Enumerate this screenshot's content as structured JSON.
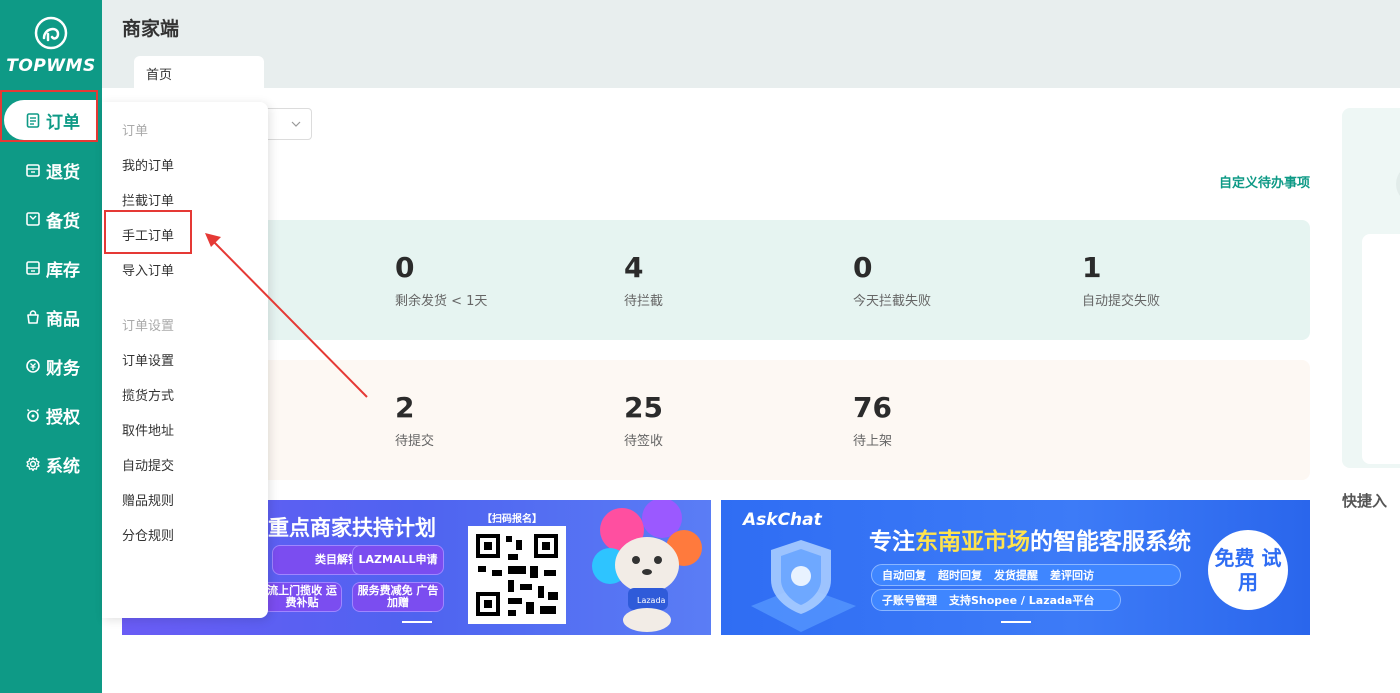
{
  "app": {
    "logo_text": "TOPWMS",
    "title": "商家端",
    "accent_color": "#0e9a86"
  },
  "tabs": [
    {
      "label": "首页"
    }
  ],
  "sidebar": {
    "items": [
      {
        "label": "订单",
        "icon": "order-icon",
        "active": true
      },
      {
        "label": "退货",
        "icon": "return-icon"
      },
      {
        "label": "备货",
        "icon": "stock-icon"
      },
      {
        "label": "库存",
        "icon": "inventory-icon"
      },
      {
        "label": "商品",
        "icon": "goods-icon"
      },
      {
        "label": "财务",
        "icon": "finance-icon"
      },
      {
        "label": "授权",
        "icon": "authorize-icon"
      },
      {
        "label": "系统",
        "icon": "system-icon"
      }
    ]
  },
  "dropdown": {
    "groups": [
      {
        "title": "订单",
        "items": [
          "我的订单",
          "拦截订单",
          "手工订单",
          "导入订单"
        ]
      },
      {
        "title": "订单设置",
        "items": [
          "订单设置",
          "揽货方式",
          "取件地址",
          "自动提交",
          "赠品规则",
          "分仓规则"
        ]
      }
    ],
    "highlighted_item": "手工订单"
  },
  "main": {
    "custom_todo_link": "自定义待办事项",
    "stats_row1": [
      {
        "value": "0",
        "label": "剩余发货 < 1天"
      },
      {
        "value": "4",
        "label": "待拦截"
      },
      {
        "value": "0",
        "label": "今天拦截失败"
      },
      {
        "value": "1",
        "label": "自动提交失败"
      }
    ],
    "stats_row2": [
      {
        "value": "2",
        "label": "待提交"
      },
      {
        "value": "25",
        "label": "待签收"
      },
      {
        "value": "76",
        "label": "待上架"
      }
    ],
    "quick_entry": "快捷入"
  },
  "banners": {
    "banner1": {
      "title": "重点商家扶持计划",
      "qr_label": "【扫码报名】",
      "pills": [
        "类目解锁",
        "LAZMALL申请",
        "流上门揽收 运费补贴",
        "服务费减免 广告加赠"
      ],
      "mascot_badge": "Lazada"
    },
    "banner2": {
      "brand": "AskChat",
      "title_prefix": "专注",
      "title_highlight": "东南亚市场",
      "title_suffix": "的智能客服系统",
      "features_row1": [
        "自动回复",
        "超时回复",
        "发货提醒",
        "差评回访"
      ],
      "features_row2": [
        "子账号管理",
        "支持Shopee / Lazada平台"
      ],
      "free_button": "免费 试用"
    }
  }
}
